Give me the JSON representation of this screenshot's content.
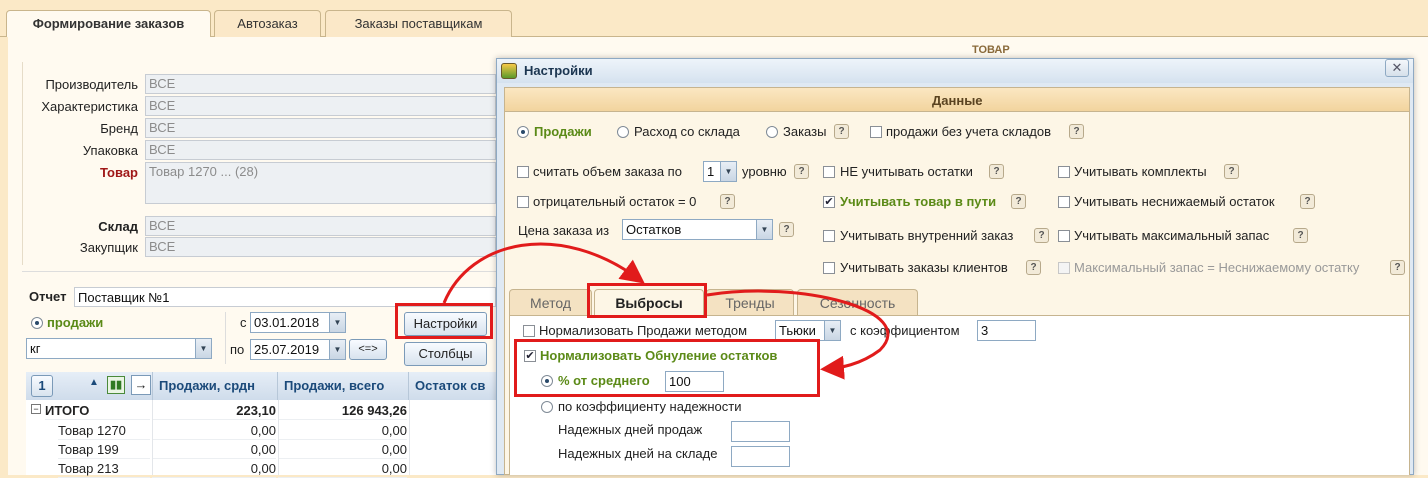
{
  "tabs": [
    "Формирование заказов",
    "Автозаказ",
    "Заказы поставщикам"
  ],
  "filters": [
    {
      "label": "Производитель",
      "value": "ВСЕ"
    },
    {
      "label": "Характеристика",
      "value": "ВСЕ"
    },
    {
      "label": "Бренд",
      "value": "ВСЕ"
    },
    {
      "label": "Упаковка",
      "value": "ВСЕ"
    },
    {
      "label": "Товар",
      "value": "Товар 1270 ... (28)"
    },
    {
      "label": "Склад",
      "value": "ВСЕ"
    },
    {
      "label": "Закупщик",
      "value": "ВСЕ"
    }
  ],
  "report": {
    "label": "Отчет",
    "name": "Поставщик №1",
    "sales_radio": "продажи",
    "unit": "кг",
    "from_label": "с",
    "from_date": "03.01.2018",
    "to_label": "по",
    "to_date": "25.07.2019",
    "swap_label": "<=>",
    "settings_btn": "Настройки",
    "columns_btn": "Столбцы"
  },
  "table": {
    "page": "1",
    "columns": [
      "Продажи, срдн",
      "Продажи, всего",
      "Остаток св"
    ],
    "rows": [
      {
        "name": "ИТОГО",
        "avg": "223,10",
        "total": "126 943,26"
      },
      {
        "name": "Товар 1270",
        "avg": "0,00",
        "total": "0,00"
      },
      {
        "name": "Товар 199",
        "avg": "0,00",
        "total": "0,00"
      },
      {
        "name": "Товар 213",
        "avg": "0,00",
        "total": "0,00"
      }
    ],
    "behind_header": "ТОВАР"
  },
  "dialog": {
    "title": "Настройки",
    "section": "Данные",
    "source_radios": [
      "Продажи",
      "Расход со склада",
      "Заказы"
    ],
    "sales_no_warehouse": "продажи без учета складов",
    "count_volume": "считать объем заказа по",
    "level_value": "1",
    "level_suffix": "уровню",
    "negative_stock": "отрицательный остаток = 0",
    "price_label": "Цена заказа из",
    "price_value": "Остатков",
    "ignore_stock": "НЕ учитывать остатки",
    "goods_in_transit": "Учитывать товар в пути",
    "internal_order": "Учитывать внутренний заказ",
    "client_orders": "Учитывать заказы клиентов",
    "kits": "Учитывать комплекты",
    "min_stock": "Учитывать неснижаемый остаток",
    "max_stock": "Учитывать максимальный запас",
    "max_eq_min": "Максимальный запас = Неснижаемому остатку",
    "inner_tabs": [
      "Метод",
      "Выбросы",
      "Тренды",
      "Сезонность"
    ],
    "normalize_sales": "Нормализовать Продажи методом",
    "method_value": "Тьюки",
    "coef_label": "с коэффициентом",
    "coef_value": "3",
    "normalize_zero": "Нормализовать Обнуление остатков",
    "pct_avg": "% от среднего",
    "pct_value": "100",
    "by_reliability": "по коэффициенту надежности",
    "reliable_sales_days": "Надежных дней продаж",
    "reliable_stock_days": "Надежных дней на складе"
  },
  "colors": {
    "accent_red": "#e11b1b",
    "green": "#5b8a17",
    "header_blue": "#1b4a7a"
  }
}
